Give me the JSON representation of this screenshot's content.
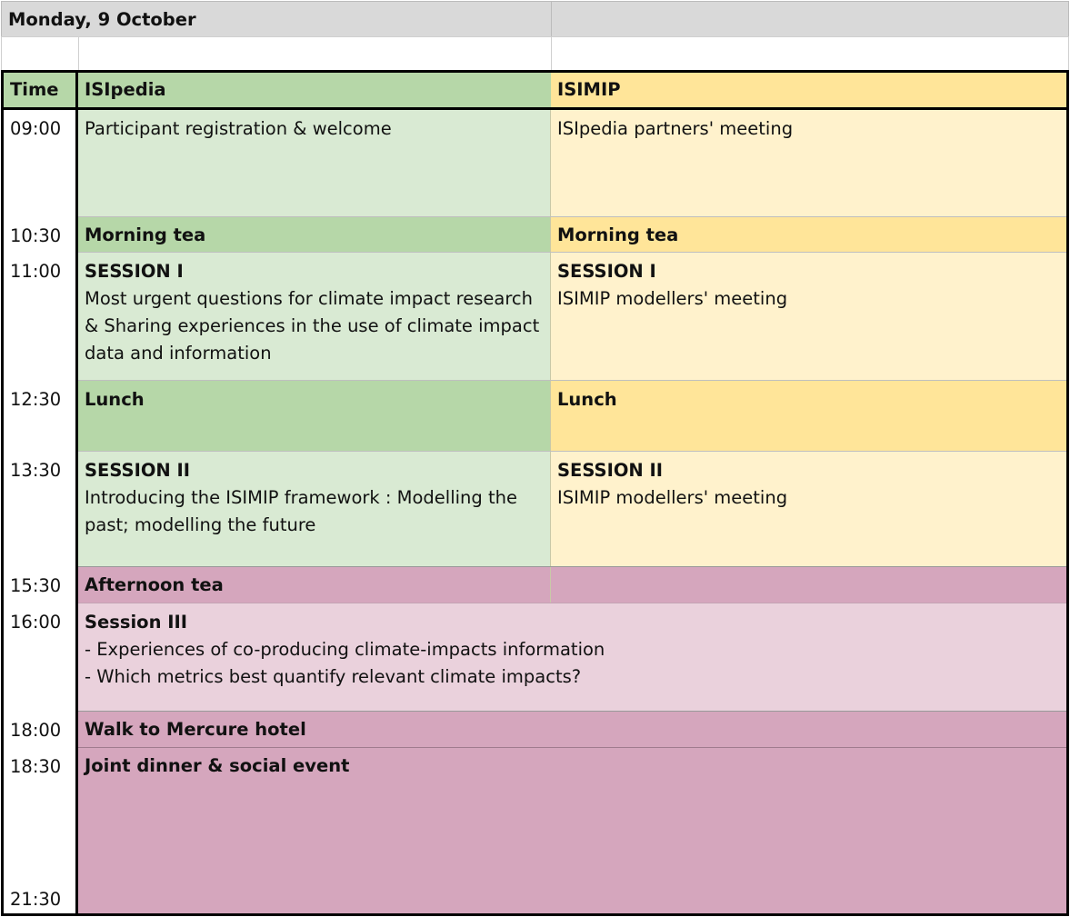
{
  "title_row": {
    "date": "Monday, 9 October",
    "right": ""
  },
  "columns": {
    "time": "Time",
    "col1": "ISIpedia",
    "col2": "ISIMIP"
  },
  "rows": {
    "r0900": {
      "time": "09:00",
      "isipedia": "Participant registration & welcome",
      "isimip": "ISIpedia partners' meeting"
    },
    "r1030": {
      "time": "10:30",
      "isipedia": "Morning tea",
      "isimip": "Morning tea"
    },
    "r1100": {
      "time": "11:00",
      "isipedia_title": "SESSION I",
      "isipedia_lines": [
        "Most urgent questions for climate impact research",
        "& Sharing experiences in the use of climate impact",
        "data and information"
      ],
      "isimip_title": "SESSION I",
      "isimip_text": "ISIMIP modellers' meeting"
    },
    "r1230": {
      "time": "12:30",
      "isipedia": "Lunch",
      "isimip": "Lunch"
    },
    "r1330": {
      "time": "13:30",
      "isipedia_title": "SESSION II",
      "isipedia_lines": [
        "Introducing the ISIMIP framework : Modelling the",
        "past; modelling the future"
      ],
      "isimip_title": "SESSION II",
      "isimip_text": "ISIMIP modellers' meeting"
    },
    "r1530": {
      "time": "15:30",
      "joint": "Afternoon tea"
    },
    "r1600": {
      "time": "16:00",
      "title": "Session III",
      "lines": [
        "- Experiences of co-producing climate-impacts information",
        "- Which metrics best quantify relevant climate impacts?"
      ]
    },
    "r1800": {
      "time": "18:00",
      "joint": "Walk to Mercure hotel"
    },
    "r1830": {
      "time": "18:30",
      "joint": "Joint dinner & social event"
    },
    "r2130": {
      "time": "21:30"
    }
  },
  "colors": {
    "isipedia_header": "#b6d7a8",
    "isipedia_body": "#d9ead3",
    "isimip_header": "#ffe599",
    "isimip_body": "#fff2cc",
    "joint_header": "#d5a6bd",
    "joint_body": "#ead1dc"
  }
}
